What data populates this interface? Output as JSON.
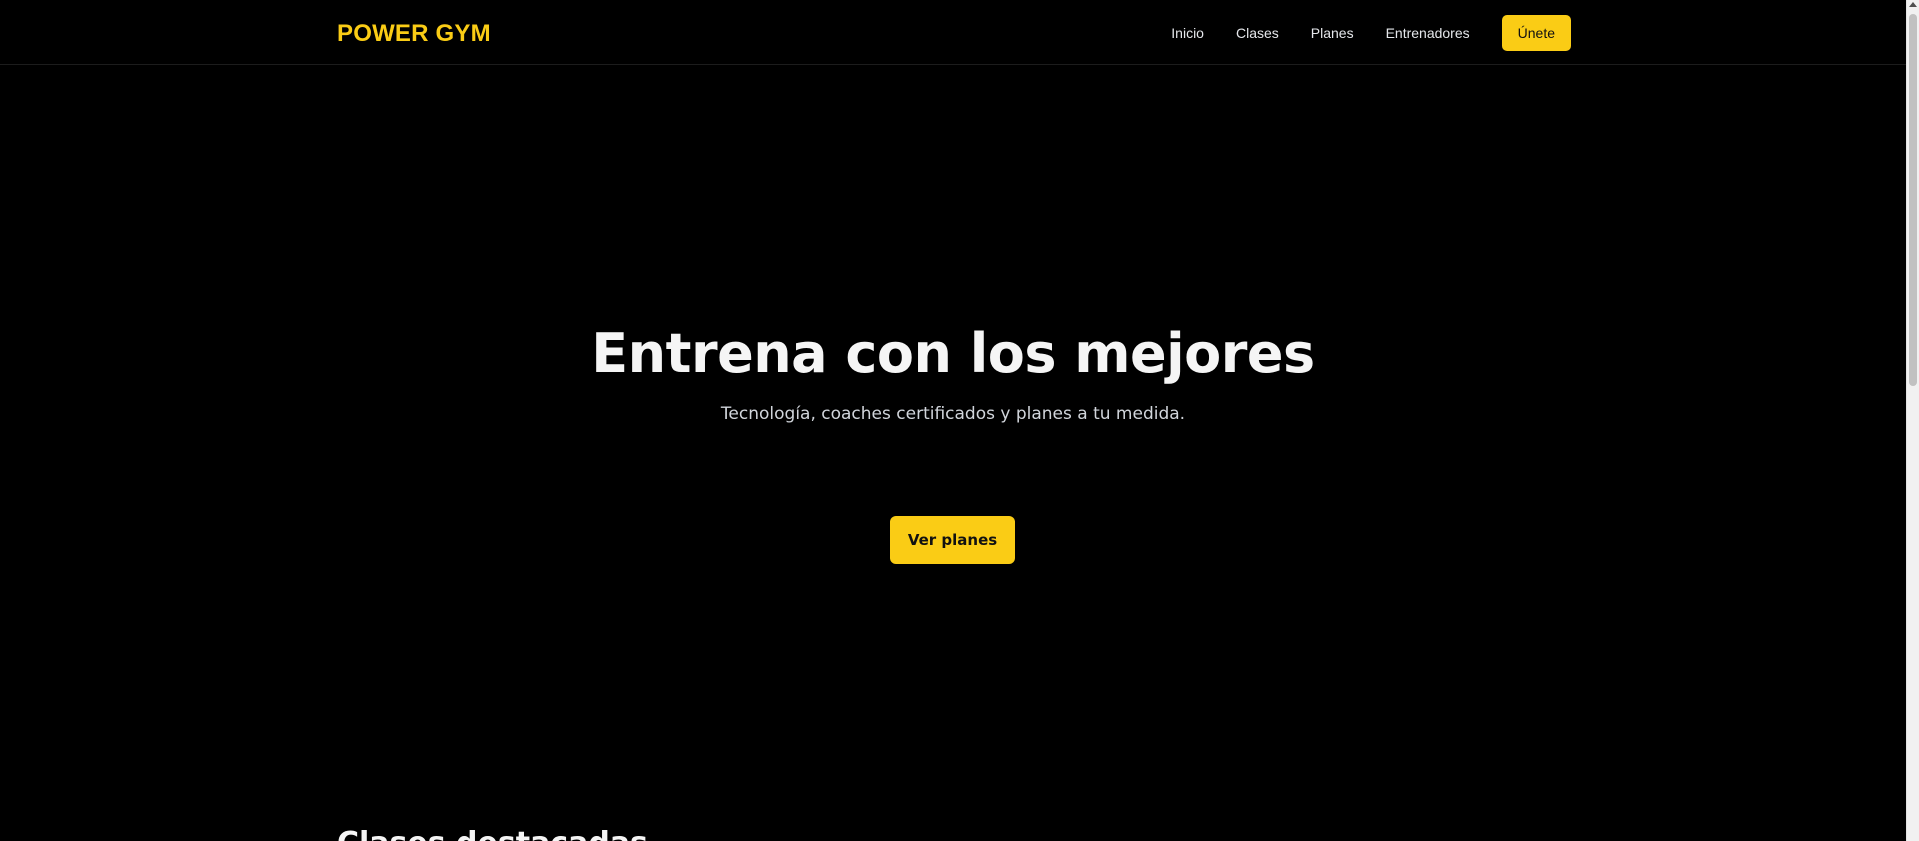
{
  "brand": {
    "name": "POWER GYM"
  },
  "nav": {
    "links": [
      "Inicio",
      "Clases",
      "Planes",
      "Entrenadores"
    ],
    "cta_label": "Únete"
  },
  "hero": {
    "title": "Entrena con los mejores",
    "subtitle": "Tecnología, coaches certificados y planes a tu medida.",
    "cta_label": "Ver planes"
  },
  "next_section": {
    "heading": "Clases destacadas"
  },
  "colors": {
    "background": "#000000",
    "accent": "#facc15",
    "text": "#f5f5f5"
  }
}
